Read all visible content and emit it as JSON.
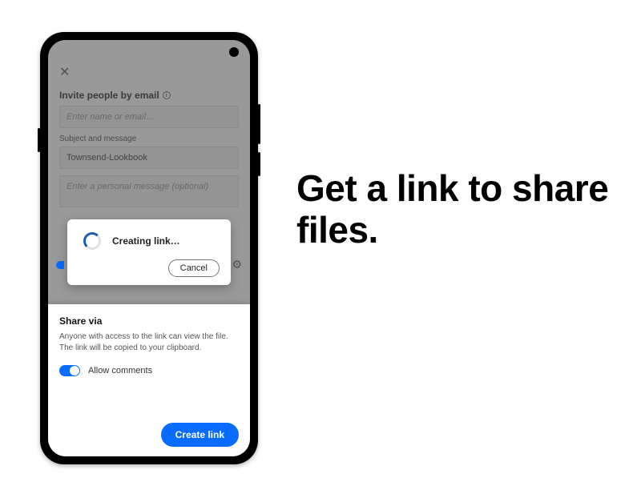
{
  "headline": "Get a link to share files.",
  "invite": {
    "title": "Invite people by email",
    "email_placeholder": "Enter name or email…",
    "subject_label": "Subject and message",
    "subject_value": "Townsend-Lookbook",
    "message_placeholder": "Enter a personal message (optional)"
  },
  "modal": {
    "status": "Creating link…",
    "cancel": "Cancel"
  },
  "share": {
    "title": "Share via",
    "description": "Anyone with access to the link can view the file. The link will be copied to your clipboard.",
    "allow_comments": "Allow comments",
    "create_button": "Create link"
  },
  "colors": {
    "accent": "#0a6cff"
  }
}
